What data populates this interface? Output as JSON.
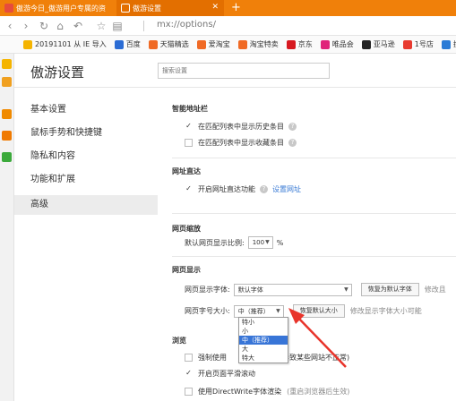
{
  "tabs": [
    {
      "title": "傲游今日_傲游用户专属的资"
    },
    {
      "title": "傲游设置"
    }
  ],
  "newtab_symbol": "+",
  "address": {
    "url": "mx://options/"
  },
  "bookmarks": [
    {
      "label": "20191101 从 IE 导入",
      "color": "#f5b400"
    },
    {
      "label": "百度",
      "color": "#2b6cd4"
    },
    {
      "label": "天猫精选",
      "color": "#f06a25"
    },
    {
      "label": "爱淘宝",
      "color": "#f06a25"
    },
    {
      "label": "淘宝特卖",
      "color": "#f06a25"
    },
    {
      "label": "京东",
      "color": "#d71920"
    },
    {
      "label": "唯品会",
      "color": "#e0247a"
    },
    {
      "label": "亚马逊",
      "color": "#222222"
    },
    {
      "label": "1号店",
      "color": "#e83a2f"
    },
    {
      "label": "携程",
      "color": "#2a7bd6"
    }
  ],
  "settings": {
    "title": "傲游设置",
    "search_placeholder": "搜索设置"
  },
  "sidenav": [
    {
      "label": "基本设置"
    },
    {
      "label": "鼠标手势和快捷键"
    },
    {
      "label": "隐私和内容"
    },
    {
      "label": "功能和扩展"
    },
    {
      "label": "高级"
    }
  ],
  "smart_address": {
    "title": "智能地址栏",
    "opt1": "在匹配列表中显示历史条目",
    "opt2": "在匹配列表中显示收藏条目"
  },
  "direct_url": {
    "title": "网址直达",
    "opt": "开启网址直达功能",
    "link": "设置网址"
  },
  "zoom": {
    "title": "网页缩放",
    "label": "默认网页显示比例:",
    "value": "100",
    "unit": "%"
  },
  "display": {
    "title": "网页显示",
    "font_label": "网页显示字体:",
    "font_value": "默认字体",
    "font_reset": "恢复为默认字体",
    "font_hint": "修改且",
    "size_label": "网页字号大小:",
    "size_value": "中（推荐）",
    "size_reset": "恢复默认大小",
    "size_hint": "修改显示字体大小可能"
  },
  "size_options": [
    "特小",
    "小",
    "中（推荐）",
    "大",
    "特大"
  ],
  "browse": {
    "title": "浏览",
    "opt1": "强制使用",
    "opt1_tail": "导致某些网站不正常)",
    "opt2": "开启页面平滑滚动",
    "opt3": "使用DirectWrite字体渲染",
    "opt3_tail": "(重启浏览器后生效)"
  },
  "colors": {
    "tabbar": "#f0800a",
    "accent_link": "#3a7bd5",
    "dropdown_selected": "#3875d7",
    "annotation": "#e8342b"
  }
}
